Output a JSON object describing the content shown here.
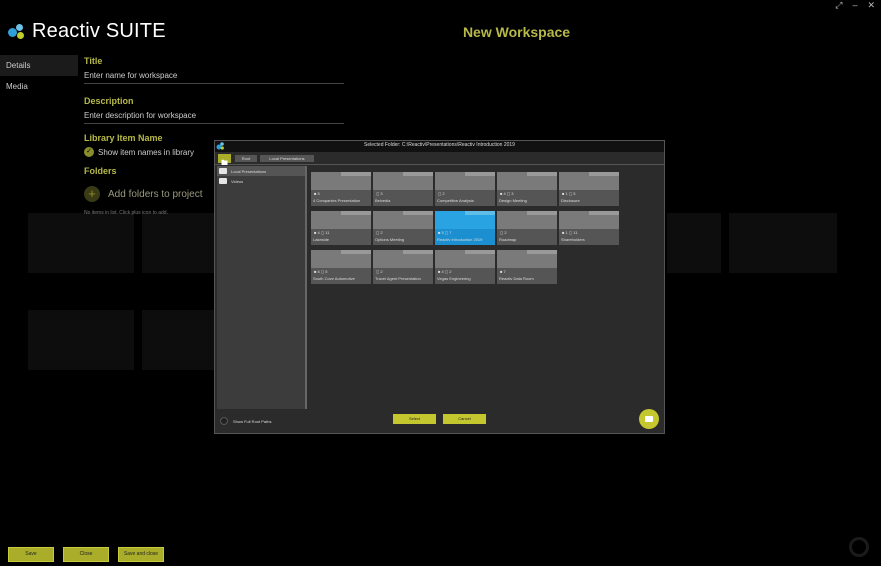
{
  "app": {
    "name": "Reactiv SUITE",
    "page_title": "New Workspace"
  },
  "nav": {
    "items": [
      {
        "label": "Details",
        "active": true
      },
      {
        "label": "Media",
        "active": false
      }
    ]
  },
  "form": {
    "title_label": "Title",
    "title_placeholder": "Enter name for workspace",
    "description_label": "Description",
    "description_placeholder": "Enter description for workspace",
    "library_label": "Library Item Name",
    "show_names_label": "Show item names in library",
    "show_names_checked": true,
    "folders_label": "Folders",
    "add_folders_label": "Add folders to project",
    "no_items_hint": "No items in list. Click plus icon to add."
  },
  "footer": {
    "save": "Save",
    "close": "Close",
    "save_close": "Save and close"
  },
  "modal": {
    "title": "Selected Folder: C:\\Reactiv\\Presentations\\Reactiv Introduction 2019",
    "breadcrumb": [
      "Root",
      "Local Presentations"
    ],
    "tree": [
      {
        "label": "Local Presentations",
        "selected": true
      },
      {
        "label": "Videos",
        "selected": false
      }
    ],
    "tiles": [
      {
        "counts": "■ 5",
        "name": "4 Companies Presentation"
      },
      {
        "counts": "◻ 3",
        "name": "Belvedia"
      },
      {
        "counts": "◻ 2",
        "name": "Competitive Analysis"
      },
      {
        "counts": "■ 4 ◻ 3",
        "name": "Design Meeting"
      },
      {
        "counts": "■ 1 ◻ 5",
        "name": "Disclosure"
      },
      {
        "counts": "■ 4 ◻ 11",
        "name": "Lakeside"
      },
      {
        "counts": "◻ 2",
        "name": "Options Meeting"
      },
      {
        "counts": "■ 5 ◻ 7",
        "name": "Reactiv Introduction 2019",
        "selected": true
      },
      {
        "counts": "◻ 2",
        "name": "Roadmap"
      },
      {
        "counts": "■ 1 ◻ 11",
        "name": "Shareholders"
      },
      {
        "counts": "■ 6 ◻ 5",
        "name": "South Cove Automotive"
      },
      {
        "counts": "◻ 2",
        "name": "Travel Agent Presentation"
      },
      {
        "counts": "■ 4 ◻ 2",
        "name": "Vegas Engineering"
      },
      {
        "counts": "■ 7",
        "name": "Reactiv Data Room"
      }
    ],
    "show_full_root_paths": "Show Full Root Paths",
    "select": "Select",
    "cancel": "Cancel"
  },
  "colors": {
    "accent": "#b6b84a",
    "button": "#c4c82e",
    "selected_tile": "#1b8fd0"
  }
}
